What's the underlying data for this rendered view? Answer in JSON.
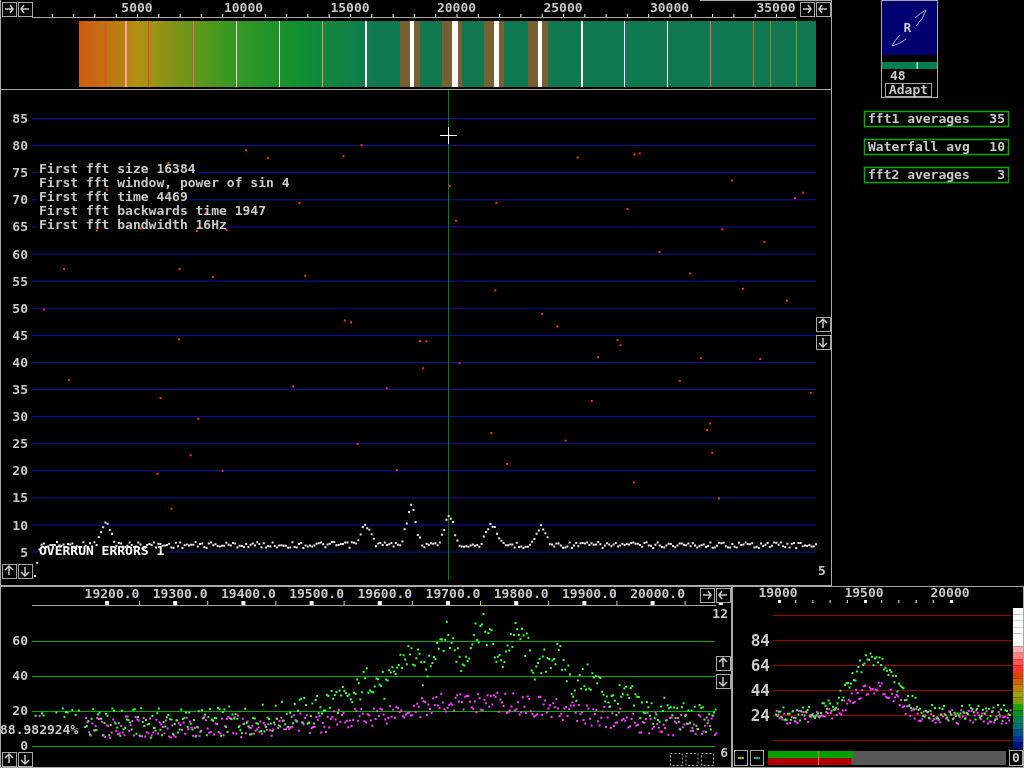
{
  "waterfall": {
    "scale_labels": [
      "5000",
      "10000",
      "15000",
      "20000",
      "25000",
      "30000",
      "35000"
    ]
  },
  "spectrum": {
    "y_labels": [
      "85",
      "80",
      "75",
      "70",
      "65",
      "60",
      "55",
      "50",
      "45",
      "40",
      "35",
      "30",
      "25",
      "20",
      "15",
      "10",
      "5"
    ],
    "info_lines": [
      "First fft size 16384",
      "First fft window, power of sin 4",
      "First fft time 4469",
      "First fft backwards time 1947",
      "First fft bandwidth 16Hz"
    ],
    "overrun": "OVERRUN ERRORS 1",
    "corner_value": "5"
  },
  "s_meter": {
    "letter": "R",
    "value": "48",
    "button": "Adapt",
    "level": 0.63
  },
  "settings": [
    {
      "label": "fft1 averages",
      "value": "35"
    },
    {
      "label": "Waterfall avg",
      "value": "10"
    },
    {
      "label": "fft2 averages",
      "value": "3"
    }
  ],
  "baseband": {
    "x_labels": [
      "19200.0",
      "19300.0",
      "19400.0",
      "19500.0",
      "19600.0",
      "19700.0",
      "19800.0",
      "19900.0",
      "20000.0"
    ],
    "y_labels": [
      "60",
      "40",
      "20",
      "0"
    ],
    "percent": "88.982924%",
    "top_value": "12",
    "bottom_value": "6"
  },
  "afc": {
    "x_labels": [
      "19000",
      "19500",
      "20000"
    ],
    "y_labels": [
      "84",
      "64",
      "44",
      "24"
    ],
    "counter": "0",
    "bars": [
      {
        "color": "#00a000",
        "level": 0.36
      },
      {
        "color": "#b00000",
        "level": 0.35
      }
    ],
    "marker": {
      "level": 0.21
    }
  }
}
